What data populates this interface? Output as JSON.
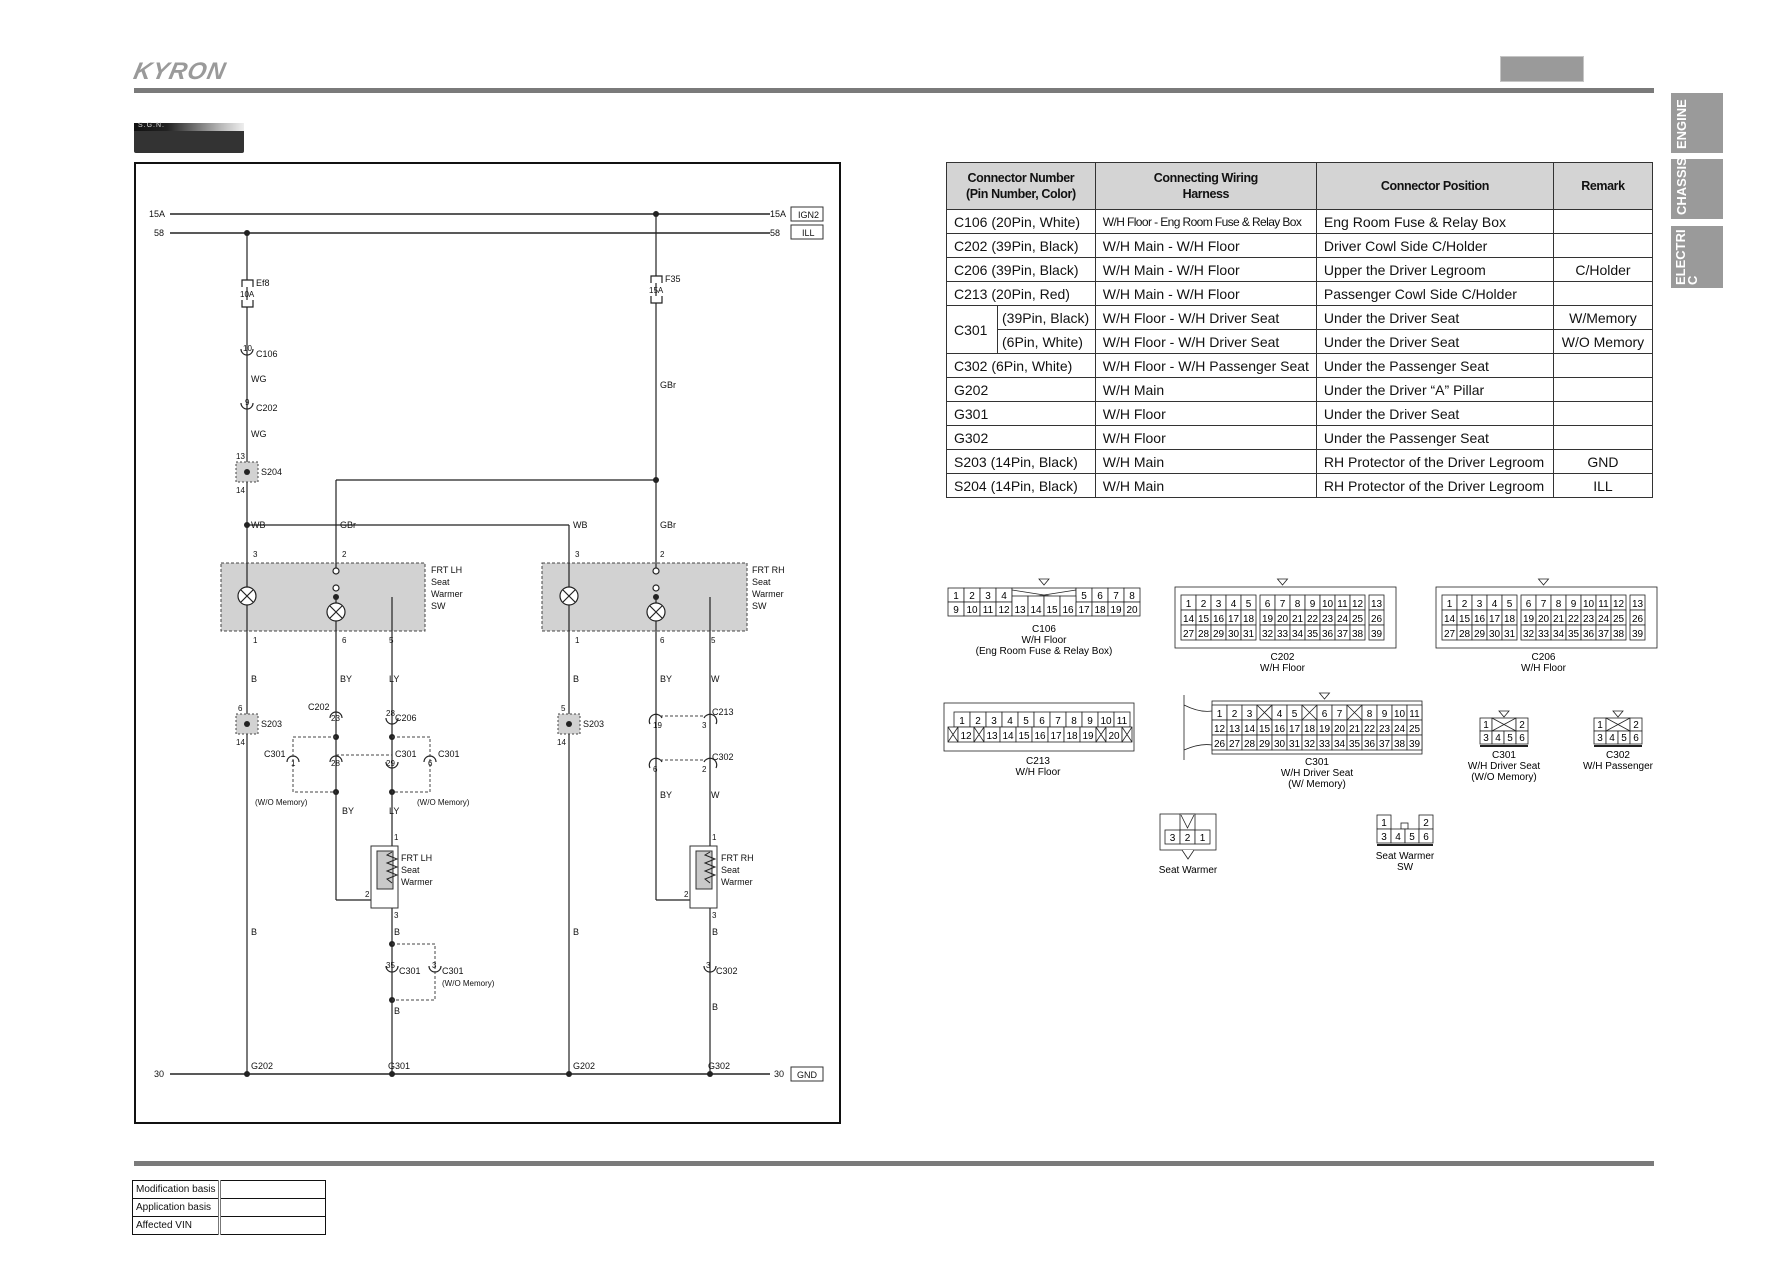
{
  "header": {
    "brand": "KYRON",
    "section_badge": "S.G.N."
  },
  "side_tabs": [
    "ENGINE",
    "CHASSIS",
    "ELECTRI\nC"
  ],
  "schematic": {
    "rails": {
      "top_left_1": "15A",
      "top_left_2": "58",
      "top_right_1": "15A",
      "top_right_2": "58",
      "tag_ign2": "IGN2",
      "tag_ill": "ILL",
      "ground_left": "30",
      "ground_right": "30",
      "tag_gnd": "GND"
    },
    "fuses": [
      {
        "name": "Ef8",
        "rating": "10A"
      },
      {
        "name": "F35",
        "rating": "15A"
      }
    ],
    "left_feed": {
      "c106": {
        "pin": "10",
        "name": "C106"
      },
      "wire1": "WG",
      "c202": {
        "pin": "9",
        "name": "C202"
      },
      "wire2": "WG",
      "s204": {
        "name": "S204",
        "pin_top": "13",
        "pin_bottom": "14"
      }
    },
    "right_feed_wire": "GBr",
    "lh_switch": {
      "label": [
        "FRT LH",
        "Seat",
        "Warmer",
        "SW"
      ],
      "wire_in_1": "WB",
      "wire_in_2": "GBr",
      "pin_3": "3",
      "pin_2": "2",
      "pin_1": "1",
      "pin_6": "6",
      "pin_5": "5",
      "wire_b": "B",
      "wire_by": "BY",
      "wire_ly": "LY"
    },
    "rh_switch": {
      "label": [
        "FRT RH",
        "Seat",
        "Warmer",
        "SW"
      ],
      "wire_in_1": "WB",
      "wire_in_2": "GBr",
      "pin_3": "3",
      "pin_2": "2",
      "pin_1": "1",
      "pin_6": "6",
      "pin_5": "5",
      "wire_b": "B",
      "wire_by": "BY",
      "wire_w": "W"
    },
    "lh_connectors": {
      "s203": {
        "name": "S203",
        "pin_top": "6",
        "pin_bottom": "14"
      },
      "c202": {
        "name": "C202",
        "pin": "23"
      },
      "c206": {
        "name": "C206",
        "pin": "28"
      },
      "c301_a": {
        "name": "C301",
        "pin": "1"
      },
      "c301_b": {
        "pin": "28"
      },
      "c301_c": {
        "name": "C301",
        "pin": "29"
      },
      "c301_d": {
        "name": "C301",
        "pin": "6"
      },
      "wo_memory_left": "(W/O Memory)",
      "wo_memory_right": "(W/O Memory)",
      "wire_by": "BY",
      "wire_ly": "LY"
    },
    "rh_connectors": {
      "s203": {
        "name": "S203",
        "pin_top": "5",
        "pin_bottom": "14"
      },
      "c213": {
        "name": "C213",
        "pin_a": "19",
        "pin_b": "3"
      },
      "c302": {
        "name": "C302",
        "pin_a": "6",
        "pin_b": "2"
      },
      "wire_by": "BY",
      "wire_w": "W"
    },
    "lh_warmer": {
      "label": [
        "FRT LH",
        "Seat",
        "Warmer"
      ],
      "pin_1": "1",
      "pin_2": "2",
      "pin_3": "3",
      "wire_b1": "B",
      "c301_a": {
        "name": "C301",
        "pin": "35"
      },
      "c301_b": {
        "name": "C301",
        "pin": "3",
        "note": "(W/O Memory)"
      },
      "wire_b2": "B",
      "wire_b_left": "B"
    },
    "rh_warmer": {
      "label": [
        "FRT RH",
        "Seat",
        "Warmer"
      ],
      "pin_1": "1",
      "pin_2": "2",
      "pin_3": "3",
      "wire_b1": "B",
      "c302": {
        "name": "C302",
        "pin": "3"
      },
      "wire_b2": "B",
      "wire_b_left": "B"
    },
    "grounds": [
      "G202",
      "G301",
      "G202",
      "G302"
    ]
  },
  "connector_table": {
    "headers": [
      "Connector Number\n(Pin Number, Color)",
      "Connecting Wiring\nHarness",
      "Connector Position",
      "Remark"
    ],
    "rows": [
      {
        "number": "C106 (20Pin, White)",
        "harness": "W/H Floor - Eng Room Fuse & Relay Box",
        "position": "Eng Room Fuse & Relay Box",
        "remark": ""
      },
      {
        "number": "C202 (39Pin, Black)",
        "harness": "W/H Main - W/H Floor",
        "position": "Driver Cowl Side C/Holder",
        "remark": ""
      },
      {
        "number": "C206 (39Pin, Black)",
        "harness": "W/H Main - W/H Floor",
        "position": "Upper the Driver Legroom",
        "remark": "C/Holder"
      },
      {
        "number": "C213 (20Pin, Red)",
        "harness": "W/H Main - W/H Floor",
        "position": "Passenger Cowl Side C/Holder",
        "remark": ""
      },
      {
        "number": "C301",
        "sub": "(39Pin, Black)",
        "harness": "W/H Floor - W/H Driver Seat",
        "position": "Under the Driver Seat",
        "remark": "W/Memory"
      },
      {
        "number": "C301",
        "sub": "(6Pin, White)",
        "harness": "W/H Floor - W/H Driver Seat",
        "position": "Under the Driver Seat",
        "remark": "W/O Memory"
      },
      {
        "number": "C302 (6Pin, White)",
        "harness": "W/H Floor - W/H Passenger Seat",
        "position": "Under the Passenger Seat",
        "remark": ""
      },
      {
        "number": "G202",
        "harness": "W/H Main",
        "position": "Under the Driver “A” Pillar",
        "remark": ""
      },
      {
        "number": "G301",
        "harness": "W/H Floor",
        "position": "Under the Driver Seat",
        "remark": ""
      },
      {
        "number": "G302",
        "harness": "W/H Floor",
        "position": "Under the Passenger Seat",
        "remark": ""
      },
      {
        "number": "S203 (14Pin, Black)",
        "harness": "W/H Main",
        "position": "RH Protector of the Driver Legroom",
        "remark": "GND"
      },
      {
        "number": "S204 (14Pin, Black)",
        "harness": "W/H Main",
        "position": "RH Protector of the Driver Legroom",
        "remark": "ILL"
      }
    ]
  },
  "connector_views": {
    "c106": {
      "caption": [
        "C106",
        "W/H Floor",
        "(Eng Room Fuse & Relay Box)"
      ],
      "row1_left": [
        "1",
        "2",
        "3",
        "4"
      ],
      "row1_right": [
        "5",
        "6",
        "7",
        "8"
      ],
      "row2_left": [
        "9",
        "10",
        "11",
        "12"
      ],
      "row2_mid": [
        "13",
        "14",
        "15",
        "16"
      ],
      "row2_right": [
        "17",
        "18",
        "19",
        "20"
      ]
    },
    "c202": {
      "caption": [
        "C202",
        "W/H Floor"
      ],
      "rows": [
        [
          "1",
          "2",
          "3",
          "4",
          "5",
          "6",
          "7",
          "8",
          "9",
          "10",
          "11",
          "12",
          "13"
        ],
        [
          "14",
          "15",
          "16",
          "17",
          "18",
          "19",
          "20",
          "21",
          "22",
          "23",
          "24",
          "25",
          "26"
        ],
        [
          "27",
          "28",
          "29",
          "30",
          "31",
          "32",
          "33",
          "34",
          "35",
          "36",
          "37",
          "38",
          "39"
        ]
      ]
    },
    "c206": {
      "caption": [
        "C206",
        "W/H Floor"
      ],
      "rows": [
        [
          "1",
          "2",
          "3",
          "4",
          "5",
          "6",
          "7",
          "8",
          "9",
          "10",
          "11",
          "12",
          "13"
        ],
        [
          "14",
          "15",
          "16",
          "17",
          "18",
          "19",
          "20",
          "21",
          "22",
          "23",
          "24",
          "25",
          "26"
        ],
        [
          "27",
          "28",
          "29",
          "30",
          "31",
          "32",
          "33",
          "34",
          "35",
          "36",
          "37",
          "38",
          "39"
        ]
      ]
    },
    "c213": {
      "caption": [
        "C213",
        "W/H Floor"
      ],
      "row1": [
        "1",
        "2",
        "3",
        "4",
        "5",
        "6",
        "7",
        "8",
        "9",
        "10",
        "11"
      ],
      "row2": [
        "X",
        "12",
        "X",
        "13",
        "14",
        "15",
        "16",
        "17",
        "18",
        "19",
        "X",
        "20",
        "X"
      ]
    },
    "c301_mem": {
      "caption": [
        "C301",
        "W/H Driver Seat",
        "(W/ Memory)"
      ],
      "rows": [
        [
          "1",
          "2",
          "3",
          "X",
          "4",
          "5",
          "X",
          "6",
          "7",
          "X",
          "8",
          "9",
          "10",
          "11"
        ],
        [
          "12",
          "13",
          "14",
          "15",
          "16",
          "17",
          "18",
          "19",
          "20",
          "21",
          "22",
          "23",
          "24",
          "25"
        ],
        [
          "26",
          "27",
          "28",
          "29",
          "30",
          "31",
          "32",
          "33",
          "34",
          "35",
          "36",
          "37",
          "38",
          "39"
        ]
      ]
    },
    "c301_nomem": {
      "caption": [
        "C301",
        "W/H Driver Seat",
        "(W/O Memory)"
      ],
      "row1": [
        "1",
        "X",
        "2"
      ],
      "row2": [
        "3",
        "4",
        "5",
        "6"
      ]
    },
    "c302": {
      "caption": [
        "C302",
        "W/H Passenger"
      ],
      "row1": [
        "1",
        "X",
        "2"
      ],
      "row2": [
        "3",
        "4",
        "5",
        "6"
      ]
    },
    "seat_warmer": {
      "caption": [
        "Seat Warmer"
      ],
      "pins": [
        "3",
        "2",
        "1"
      ]
    },
    "seat_warmer_sw": {
      "caption": [
        "Seat Warmer",
        "SW"
      ],
      "row1": [
        "1",
        "2"
      ],
      "row2": [
        "3",
        "4",
        "5",
        "6"
      ]
    }
  },
  "modification_table": {
    "rows": [
      {
        "label": "Modification basis",
        "value": ""
      },
      {
        "label": "Application basis",
        "value": ""
      },
      {
        "label": "Affected VIN",
        "value": ""
      }
    ]
  }
}
